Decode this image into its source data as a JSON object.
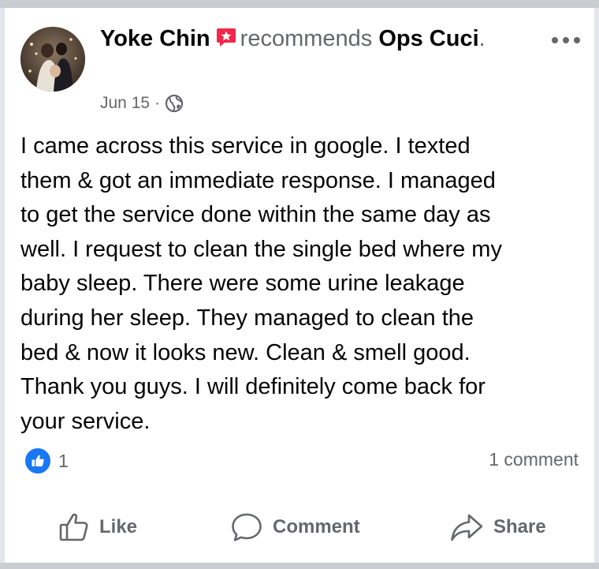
{
  "post": {
    "author": "Yoke Chin",
    "verb": "recommends",
    "page_name": "Ops Cuci",
    "period": ".",
    "date": "Jun 15",
    "separator": "·",
    "body": "I came across this service in google. I texted\nthem & got an immediate response. I managed\nto get the service done within the same day as\nwell. I request to clean the single bed where my\nbaby sleep. There were some urine leakage\nduring her sleep. They managed to clean the\nbed & now it looks new. Clean & smell good.\nThank you guys. I will definitely come back for\nyour service."
  },
  "stats": {
    "reaction_count": "1",
    "comments": "1 comment"
  },
  "actions": {
    "like": "Like",
    "comment": "Comment",
    "share": "Share"
  },
  "icons": {
    "badge": "recommendation-badge-icon",
    "privacy": "globe-icon",
    "more": "more-options-icon",
    "reaction": "like-reaction-icon"
  },
  "colors": {
    "accent": "#1877f2",
    "badge": "#f02849",
    "secondary_text": "#65676b"
  }
}
